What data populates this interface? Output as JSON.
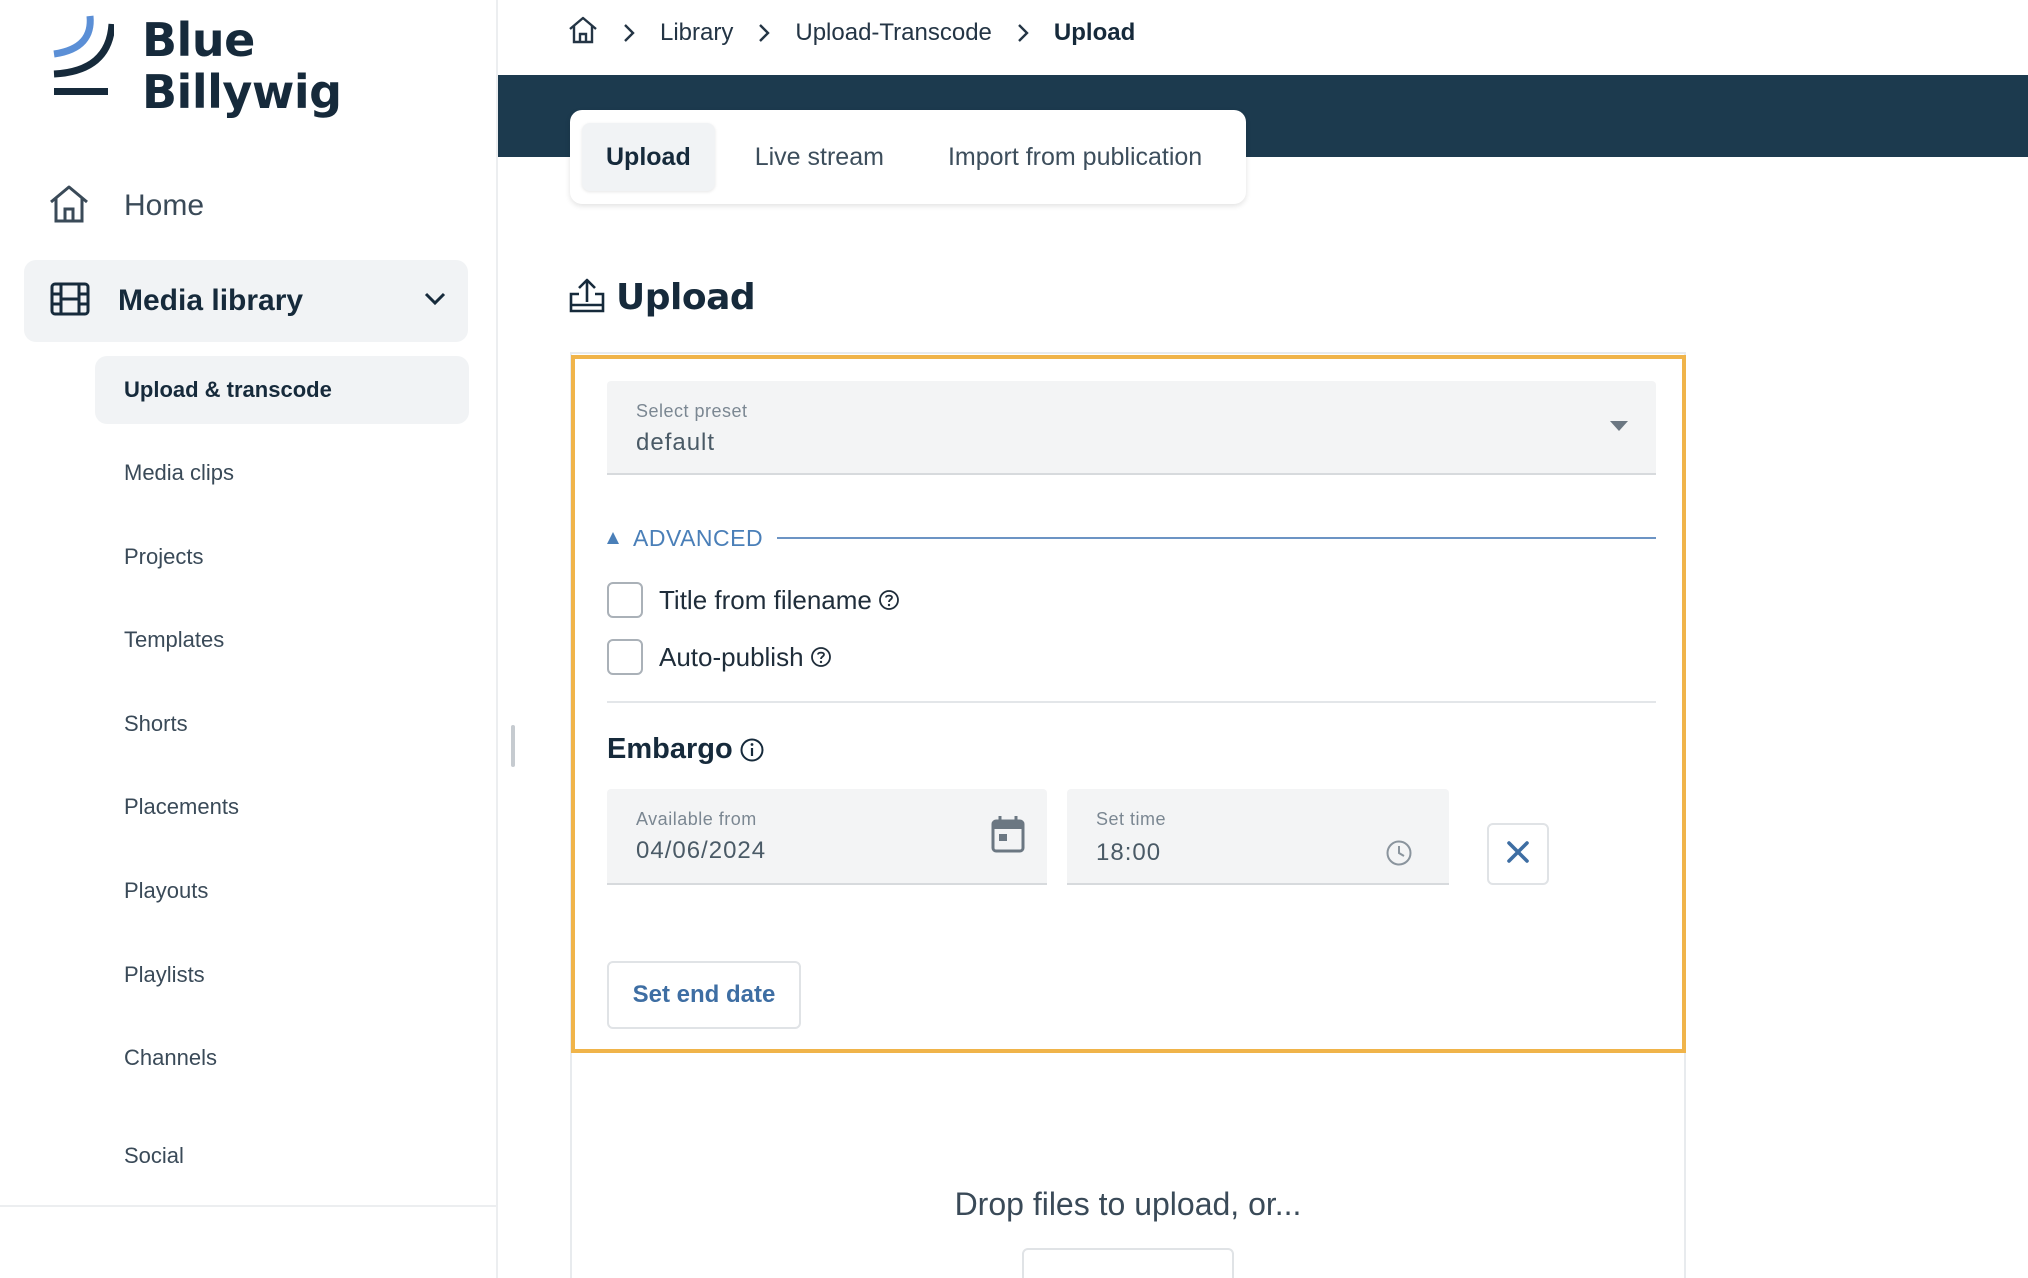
{
  "brand": {
    "line1": "Blue",
    "line2": "Billywig",
    "accent": "#5b8fd6",
    "dark": "#162a3b"
  },
  "sidebar": {
    "home_label": "Home",
    "media_library_label": "Media library",
    "items": [
      {
        "label": "Upload & transcode",
        "active": true
      },
      {
        "label": "Media clips"
      },
      {
        "label": "Projects"
      },
      {
        "label": "Templates"
      },
      {
        "label": "Shorts"
      },
      {
        "label": "Placements"
      },
      {
        "label": "Playouts"
      },
      {
        "label": "Playlists"
      },
      {
        "label": "Channels"
      },
      {
        "label": "Social"
      }
    ]
  },
  "breadcrumb": {
    "items": [
      "Library",
      "Upload-Transcode"
    ],
    "current": "Upload"
  },
  "tabs": [
    {
      "label": "Upload",
      "active": true
    },
    {
      "label": "Live stream"
    },
    {
      "label": "Import from publication"
    }
  ],
  "section_title": "Upload",
  "upload_form": {
    "preset": {
      "caption": "Select preset",
      "value": "default"
    },
    "advanced_label": "ADVANCED",
    "title_from_filename": {
      "label": "Title from filename",
      "checked": false
    },
    "auto_publish": {
      "label": "Auto-publish",
      "checked": false
    },
    "embargo_title": "Embargo",
    "available_from": {
      "caption": "Available from",
      "value": "04/06/2024"
    },
    "set_time": {
      "caption": "Set time",
      "value": "18:00"
    },
    "set_end_date_label": "Set end date"
  },
  "dropzone": {
    "text": "Drop files to upload, or..."
  },
  "colors": {
    "highlight_border": "#f0b44a",
    "banner": "#1c3a4e",
    "link_blue": "#3e6ea3"
  }
}
